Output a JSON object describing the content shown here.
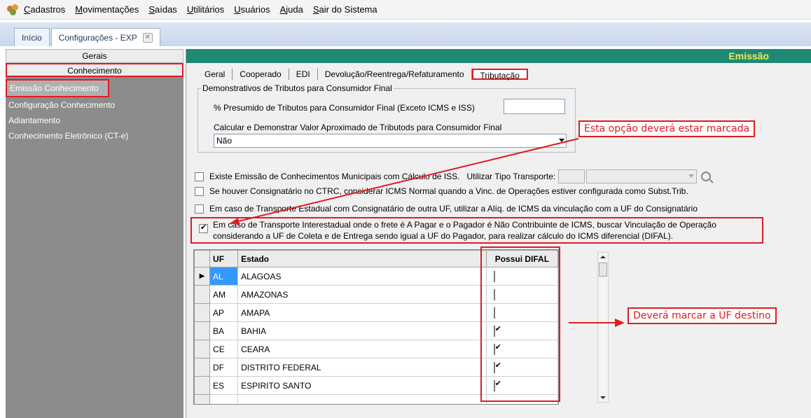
{
  "menubar": {
    "items": [
      "Cadastros",
      "Movimentações",
      "Saídas",
      "Utilitários",
      "Usuários",
      "Ajuda",
      "Sair do Sistema"
    ]
  },
  "tabs": [
    {
      "label": "Início"
    },
    {
      "label": "Configurações - EXP"
    }
  ],
  "sidebar": {
    "section_gerais": "Gerais",
    "section_conhecimento": "Conhecimento",
    "items": [
      {
        "label": "Emissão Conhecimento"
      },
      {
        "label": "Configuração Conhecimento"
      },
      {
        "label": "Adiantamento"
      },
      {
        "label": "Conhecimento Eletrônico (CT-e)"
      }
    ]
  },
  "panel": {
    "title": "Emissão",
    "subtabs": [
      "Geral",
      "Cooperado",
      "EDI",
      "Devolução/Reentrega/Refaturamento",
      "Tributação"
    ],
    "group": {
      "legend": "Demonstrativos de Tributos para Consumidor Final",
      "presumido_label": "% Presumido de Tributos para  Consumidor Final (Exceto ICMS e ISS)",
      "presumido_value": "",
      "calcular_label": "Calcular e Demonstrar Valor Aproximado de Tributods para Consumidor Final",
      "calcular_value": "Não"
    },
    "checks": {
      "municipais": "Existe Emissão de Conhecimentos Municipais com Cálculo de ISS.",
      "tipo_transporte_label": "Utilizar Tipo Transporte:",
      "consignatario": "Se houver Consignatário no CTRC, considerar ICMS Normal quando a Vinc. de Operações estiver configurada como Subst.Trib.",
      "estadual": "Em caso de Transporte Estadual com Consignatário de outra UF, utilizar a Alíq. de ICMS da vinculação com a UF do Consignatário",
      "difal_line1": "Em caso de Transporte Interestadual onde o frete é A Pagar e o Pagador é Não Contribuinte de ICMS, buscar Vinculação de Operação",
      "difal_line2": "considerando a UF de Coleta e de Entrega sendo igual a UF do Pagador, para realizar cálculo do ICMS diferencial (DIFAL)."
    },
    "grid": {
      "headers": {
        "uf": "UF",
        "estado": "Estado",
        "difal": "Possui DIFAL"
      },
      "rows": [
        {
          "uf": "AL",
          "estado": "ALAGOAS",
          "difal": false
        },
        {
          "uf": "AM",
          "estado": "AMAZONAS",
          "difal": false
        },
        {
          "uf": "AP",
          "estado": "AMAPA",
          "difal": false
        },
        {
          "uf": "BA",
          "estado": "BAHIA",
          "difal": true
        },
        {
          "uf": "CE",
          "estado": "CEARA",
          "difal": true
        },
        {
          "uf": "DF",
          "estado": "DISTRITO FEDERAL",
          "difal": true
        },
        {
          "uf": "ES",
          "estado": "ESPIRITO SANTO",
          "difal": true
        }
      ]
    }
  },
  "annotations": {
    "marcada": "Esta opção deverá estar marcada",
    "uf_destino": "Deverá marcar a UF destino"
  },
  "colors": {
    "accent_red": "#e11b22",
    "header_green": "#1e8a75",
    "title_yellow": "#f4e84a"
  }
}
